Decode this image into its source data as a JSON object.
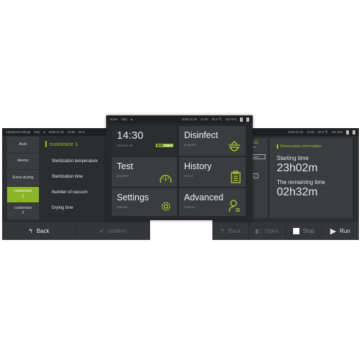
{
  "left_screen": {
    "header": {
      "title": "Advanced settings",
      "help": "help",
      "date": "2018.11.19",
      "time": "14:30",
      "temp": "25.3"
    },
    "sidebar": [
      {
        "label": "Auto"
      },
      {
        "label": "device"
      },
      {
        "label": "Extra drying"
      },
      {
        "label": "customize\n1",
        "active": true
      },
      {
        "label": "customize\n2"
      }
    ],
    "section_title": "customize 1",
    "rows": [
      "Sterilization temperature",
      "Sterilization time",
      "Number of vacuum",
      "Drying time"
    ],
    "footer": {
      "back": "Back",
      "confirm": "confirm"
    }
  },
  "center_screen": {
    "header": {
      "home": "Home",
      "help": "help",
      "date": "2018.11.19",
      "time": "14:30",
      "temp": "25.3 ℃",
      "pressure": "101 kPa"
    },
    "clock": {
      "time": "14:30",
      "date": "2018.11.19",
      "logo": "BAYONed"
    },
    "tiles": [
      {
        "title": "Disinfect",
        "subtitle": "program",
        "icon": "sterilizer-icon"
      },
      {
        "title": "Test",
        "subtitle": "program",
        "icon": "gauge-icon"
      },
      {
        "title": "History",
        "subtitle": "record",
        "icon": "clipboard-icon"
      },
      {
        "title": "Settings",
        "subtitle": "Options",
        "icon": "gear-icon"
      },
      {
        "title": "Advanced",
        "subtitle": "Options",
        "icon": "user-settings-icon"
      }
    ]
  },
  "right_screen": {
    "header": {
      "date": "2018.11.19",
      "time": "14:30",
      "temp": "25.3 ℃",
      "pressure": "101 kPa"
    },
    "side_card": {
      "num": "121",
      "line": "ent...",
      "badge1": "ssure",
      "badge2": "us"
    },
    "reservation": {
      "title": "Reservation information",
      "start_label": "Starting time",
      "start_value": "23h02m",
      "remain_label": "The remaining time",
      "remain_value": "02h32m"
    },
    "footer": {
      "back": "Back",
      "open": "Open",
      "stop": "Stop",
      "run": "Run"
    }
  },
  "colors": {
    "accent": "#9cc42c",
    "panel": "#2b2d30",
    "tile": "#3a3c40"
  }
}
